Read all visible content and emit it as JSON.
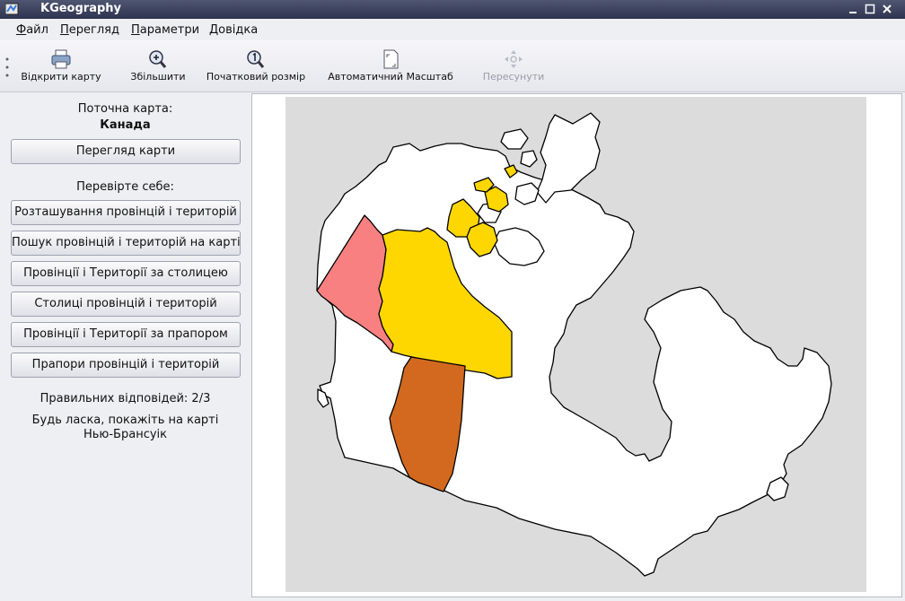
{
  "window": {
    "title": "KGeography"
  },
  "menubar": {
    "items": [
      {
        "mnemonic": "Ф",
        "rest": "айл"
      },
      {
        "mnemonic": "П",
        "rest": "ерегляд"
      },
      {
        "mnemonic": "П",
        "rest": "араметри"
      },
      {
        "mnemonic": "Д",
        "rest": "овідка"
      }
    ]
  },
  "toolbar": {
    "open_map": "Відкрити карту",
    "zoom_in": "Збільшити",
    "original_size": "Початковий розмір",
    "auto_zoom": "Автоматичний Масштаб",
    "move": "Пересунути"
  },
  "sidebar": {
    "current_map_label": "Поточна карта:",
    "current_map_name": "Канада",
    "view_map_button": "Перегляд карти",
    "test_yourself_label": "Перевірте себе:",
    "quiz_buttons": [
      "Розташування провінцій і територій",
      "Пошук провінцій і територій на карті",
      "Провінції і Території за столицею",
      "Столиці провінцій і територій",
      "Провінції і Території за прапором",
      "Прапори провінцій і територій"
    ],
    "correct_answers": "Правильних відповідей: 2/3",
    "prompt_line1": "Будь ласка, покажіть на карті",
    "prompt_line2": "Нью-Брансуік"
  },
  "map": {
    "colors": {
      "background": "#dcdcdc",
      "yukon": "#f88080",
      "nwt": "#ffd700",
      "alberta": "#d2691e",
      "outline": "#000000"
    }
  }
}
